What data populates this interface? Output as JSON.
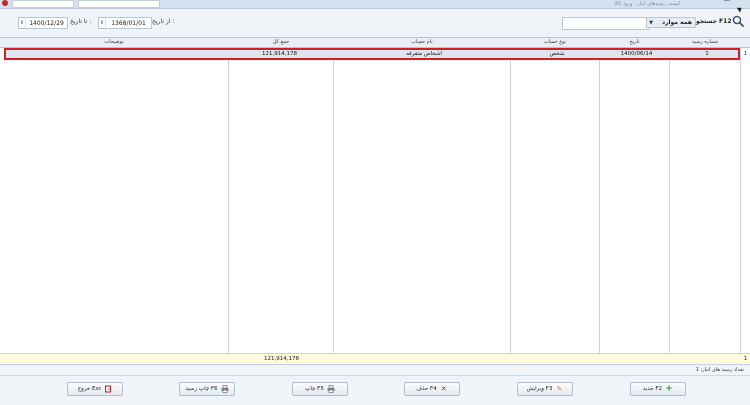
{
  "window": {
    "title": "لیست رسیدهای انبار - ورود کالا"
  },
  "filters": {
    "from_date_label": "از تاریخ :",
    "from_date_value": "1368/01/01",
    "to_date_label": "تا تاریخ :",
    "to_date_value": "1400/12/29",
    "search_label": "جستجو F12",
    "scope_value": "همه موارد",
    "search_placeholder": ""
  },
  "table": {
    "columns": [
      "شماره رسید",
      "تاریخ",
      "نوع حساب",
      "نام حساب",
      "جمع کل",
      "توضیحات"
    ],
    "rows": [
      {
        "indicator": "1",
        "number": "1",
        "date": "1400/06/14",
        "account_type": "شخص",
        "account_name": "اشخاص متفرقه",
        "total": "121,914,178",
        "description": ""
      }
    ],
    "footer": {
      "count": "1",
      "total": "121,914,178"
    }
  },
  "status": {
    "text": "تعداد رسید های انبار: 1"
  },
  "buttons": {
    "new": "جدید F2",
    "edit": "ویرایش F3",
    "delete": "حذف F4",
    "print": "چاپ F5",
    "print_receipt": "چاپ رسید F6",
    "exit": "خروج Esc"
  },
  "colors": {
    "selection_border": "#d11f2a",
    "selected_row": "#dce6f3",
    "footer_bg": "#fffbd9"
  }
}
